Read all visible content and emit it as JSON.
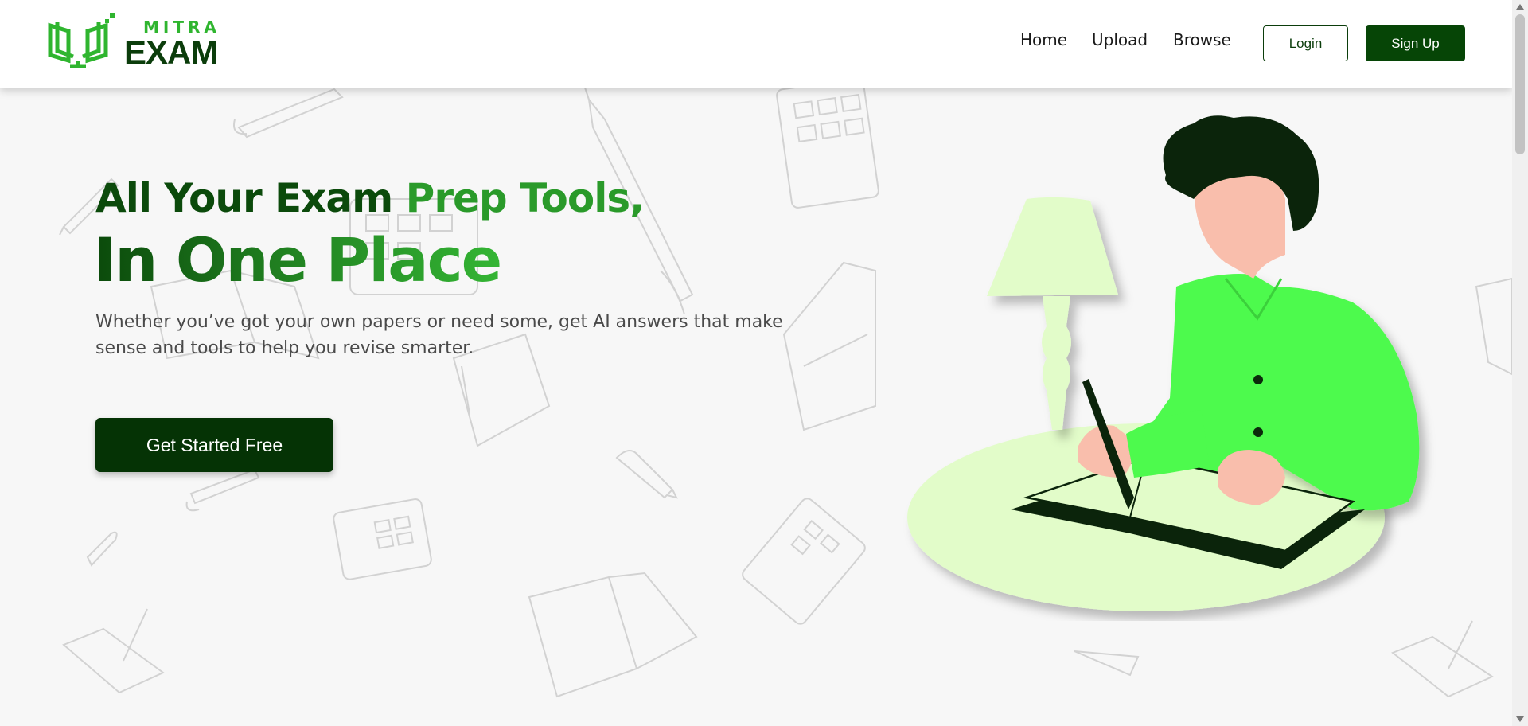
{
  "brand": {
    "top": "MITRA",
    "bottom": "EXAM",
    "colors": {
      "primary": "#064506",
      "accent": "#2fb52f"
    }
  },
  "nav": {
    "items": [
      {
        "label": "Home"
      },
      {
        "label": "Upload"
      },
      {
        "label": "Browse"
      }
    ],
    "login_label": "Login",
    "signup_label": "Sign Up"
  },
  "hero": {
    "title_part1": "All Your Exam ",
    "title_part2": "Prep Tools,",
    "title_line2": "In One Place",
    "subtitle": "Whether you’ve got your own papers or need some, get AI answers that make sense and tools to help you revise smarter.",
    "cta_label": "Get Started Free"
  },
  "illustration": {
    "icon": "student-studying-illustration",
    "background_icons": [
      "pen-icon",
      "fountain-pen-icon",
      "calculator-icon",
      "pencil-icon",
      "open-book-icon",
      "paper-icon"
    ]
  }
}
